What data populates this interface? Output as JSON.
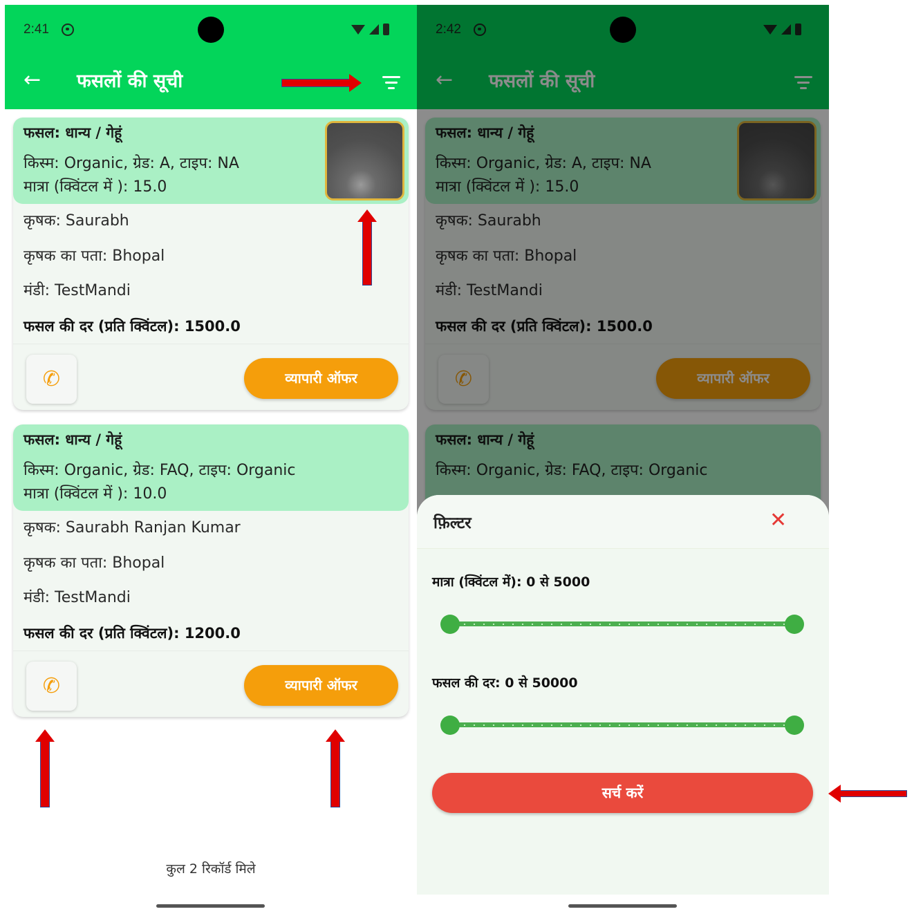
{
  "left": {
    "status_time": "2:41",
    "title": "फसलों की सूची",
    "cards": [
      {
        "crop": "फसल: धान्य / गेहूं",
        "variety": "किस्म: Organic, ग्रेड: A, टाइप: NA",
        "quantity": "मात्रा (क्विंटल में ): 15.0",
        "farmer": "कृषक: Saurabh",
        "address": "कृषक का पता: Bhopal",
        "mandi": "मंडी: TestMandi",
        "rate": "फसल की दर (प्रति क्विंटल): 1500.0",
        "offer": "व्यापारी ऑफर"
      },
      {
        "crop": "फसल: धान्य / गेहूं",
        "variety": "किस्म: Organic, ग्रेड: FAQ, टाइप: Organic",
        "quantity": "मात्रा (क्विंटल में ): 10.0",
        "farmer": "कृषक: Saurabh Ranjan Kumar",
        "address": "कृषक का पता: Bhopal",
        "mandi": "मंडी: TestMandi",
        "rate": "फसल की दर (प्रति क्विंटल): 1200.0",
        "offer": "व्यापारी ऑफर"
      }
    ],
    "footer": "कुल 2 रिकॉर्ड मिले"
  },
  "right": {
    "status_time": "2:42",
    "title": "फसलों की सूची",
    "cards": [
      {
        "crop": "फसल: धान्य / गेहूं",
        "variety": "किस्म: Organic, ग्रेड: A, टाइप: NA",
        "quantity": "मात्रा (क्विंटल में ): 15.0",
        "farmer": "कृषक: Saurabh",
        "address": "कृषक का पता: Bhopal",
        "mandi": "मंडी: TestMandi",
        "rate": "फसल की दर (प्रति क्विंटल): 1500.0",
        "offer": "व्यापारी ऑफर"
      },
      {
        "crop": "फसल: धान्य / गेहूं",
        "variety": "किस्म: Organic, ग्रेड: FAQ, टाइप: Organic"
      }
    ],
    "filter": {
      "title": "फ़िल्टर",
      "quantity_label": "मात्रा (क्विंटल में): 0 से 5000",
      "quantity_range": [
        0,
        5000
      ],
      "rate_label": "फसल की दर: 0 से 50000",
      "rate_range": [
        0,
        50000
      ],
      "search": "सर्च करें"
    }
  },
  "icons": {
    "back": "arrow-left-icon",
    "filter": "filter-icon",
    "call": "phone-icon",
    "close": "close-icon"
  },
  "colors": {
    "appbar": "#03d55a",
    "card_header": "#aaf0c5",
    "offer_button": "#f59e0b",
    "search_button": "#ea4a3d",
    "slider": "#4caf50",
    "annotation_arrow": "#e00000"
  }
}
